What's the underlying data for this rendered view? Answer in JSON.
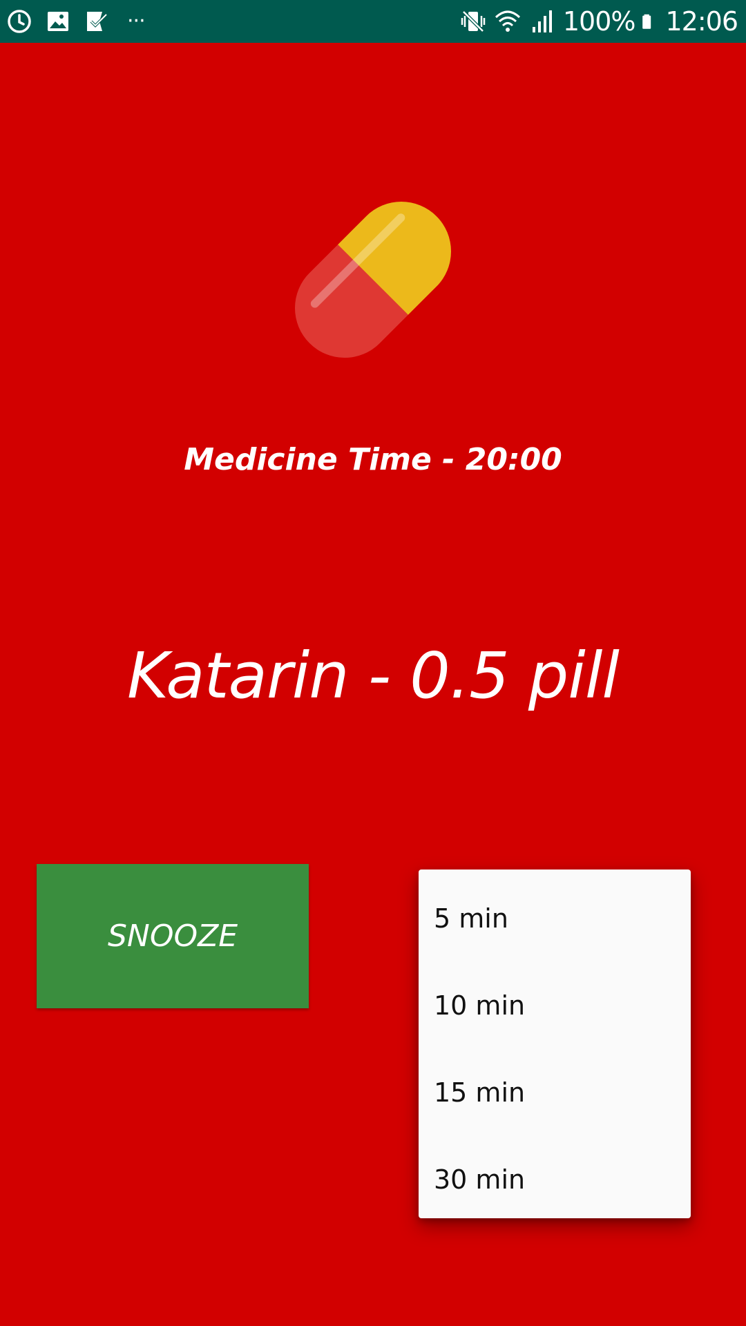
{
  "status_bar": {
    "left_icons": [
      "sync-icon",
      "image-icon",
      "checklist-icon",
      "more-notifications-icon"
    ],
    "overflow_dots": "···",
    "right_icons": [
      "vibrate-mute-icon",
      "wifi-icon",
      "signal-icon",
      "battery-icon"
    ],
    "battery_percent": "100%",
    "time": "12:06",
    "background_color": "#005a4f"
  },
  "alarm": {
    "background_color": "#d20000",
    "icon": "pill-capsule-icon",
    "medicine_time": "Medicine Time - 20:00",
    "medicine_name": "Katarin - 0.5 pill"
  },
  "snooze": {
    "button_label": "SNOOZE",
    "button_color": "#3a8e3e",
    "options": [
      "5 min",
      "10 min",
      "15 min",
      "30 min"
    ]
  }
}
